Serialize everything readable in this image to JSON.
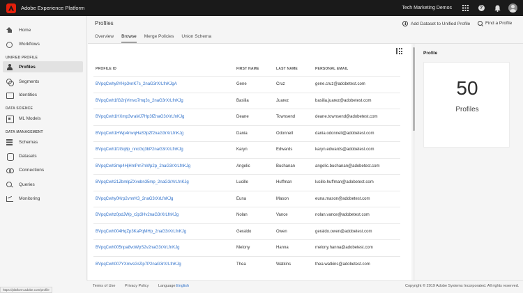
{
  "app": {
    "title": "Adobe Experience Platform",
    "org": "Tech Marketing Demos"
  },
  "sidebar": {
    "items": [
      {
        "label": "Home",
        "icon": "home-icon"
      },
      {
        "label": "Workflows",
        "icon": "workflow-icon"
      },
      {
        "label": "Profiles",
        "icon": "user-icon"
      },
      {
        "label": "Segments",
        "icon": "segments-icon"
      },
      {
        "label": "Identities",
        "icon": "identity-icon"
      },
      {
        "label": "ML Models",
        "icon": "model-icon"
      },
      {
        "label": "Schemas",
        "icon": "schema-icon"
      },
      {
        "label": "Datasets",
        "icon": "dataset-icon"
      },
      {
        "label": "Connections",
        "icon": "connection-icon"
      },
      {
        "label": "Queries",
        "icon": "query-icon"
      },
      {
        "label": "Monitoring",
        "icon": "monitoring-icon"
      }
    ],
    "sections": {
      "unified_profile": "UNIFIED PROFILE",
      "data_science": "DATA SCIENCE",
      "data_management": "DATA MANAGEMENT"
    },
    "active": "Profiles"
  },
  "header": {
    "title": "Profiles",
    "tabs": [
      "Overview",
      "Browse",
      "Merge Policies",
      "Union Schema"
    ],
    "active_tab": "Browse",
    "add_dataset": "Add Dataset to Unified Profile",
    "find_profile": "Find a Profile"
  },
  "table": {
    "columns": [
      "PROFILE ID",
      "FIRST NAME",
      "LAST NAME",
      "PERSONAL EMAIL"
    ],
    "rows": [
      [
        "BVpqCwhy8YHp3vnK7s_2naG3rXrLfnKJgA",
        "Gene",
        "Cruz",
        "gene.cruz@adobetest.com"
      ],
      [
        "BVpqCwh1fG2njVmvo7mq3s_2naG3rXrLfnKJg",
        "Basilia",
        "Juarez",
        "basilia.juarez@adobetest.com"
      ],
      [
        "BVpqCwh1HXmp3vraMJ7Hp3fZnaG3rXrLfnKJg",
        "Deane",
        "Townsend",
        "deane.townsend@adobetest.com"
      ],
      [
        "BVpqCwh1HWp4mvqHaS3pZf2naG3rXrLfnKJg",
        "Dania",
        "Odonnell",
        "dania.odonnell@adobetest.com"
      ],
      [
        "BVpqCwh1fJGq8p_nncGq3bP2naG3rXrLfnKJg",
        "Karyn",
        "Edwards",
        "karyn.edwards@adobetest.com"
      ],
      [
        "BVpqCwh3mp4HjHmPm7nWp2p_2naG3rXrLfnKJg",
        "Angelic",
        "Buchanan",
        "angelic.buchanan@adobetest.com"
      ],
      [
        "BVpqCwh21ZbmlpZXvobn35mp_2naG3rXrLfnKJg",
        "Lucille",
        "Huffman",
        "lucille.huffman@adobetest.com"
      ],
      [
        "BVpqCwhy0Krp2vnrrK3_2naG3rXrLfnKJg",
        "Euna",
        "Mason",
        "euna.mason@adobetest.com"
      ],
      [
        "BVpqCwhz0pdJWp_r2p3Hv2naG3rXrLfnKJg",
        "Nolan",
        "Vance",
        "nolan.vance@adobetest.com"
      ],
      [
        "BVpqCwh004HqZp3KaPqMHp_2naG3rXrLfnKJg",
        "Geraldo",
        "Owen",
        "geraldo.owen@adobetest.com"
      ],
      [
        "BVpqCwh005npa8voWpS2v2naG3rXrLfnKJg",
        "Melony",
        "Hanna",
        "melony.hanna@adobetest.com"
      ],
      [
        "BVpqCwh007YXmvsGrZip7P2naG3rXrLfnKJg",
        "Thea",
        "Watkins",
        "thea.watkins@adobetest.com"
      ]
    ]
  },
  "panel": {
    "title": "Profile",
    "count": "50",
    "label": "Profiles"
  },
  "footer": {
    "terms": "Terms of Use",
    "privacy": "Privacy Policy",
    "language_label": "Language:",
    "language": "English",
    "copyright": "Copyright © 2019 Adobe Systems Incorporated. All rights reserved."
  },
  "status_url": "https://platform.adobe.com/profile"
}
